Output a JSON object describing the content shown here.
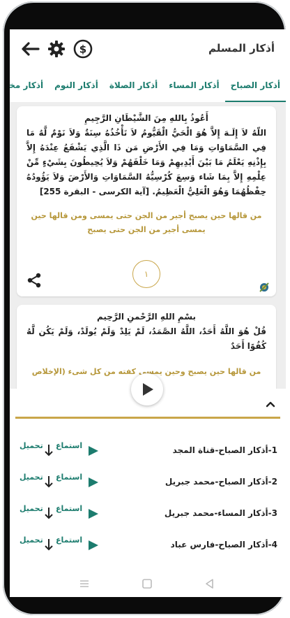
{
  "app": {
    "title": "أذكار المسلم"
  },
  "toolbar": {
    "donate_icon": "dollar-circle-icon",
    "settings_icon": "gear-icon",
    "back_icon": "arrow-left-icon"
  },
  "tabs": [
    {
      "label": "أذكار الصباح",
      "active": true
    },
    {
      "label": "أذكار المساء",
      "active": false
    },
    {
      "label": "أذكار الصلاة",
      "active": false
    },
    {
      "label": "أذكار النوم",
      "active": false
    },
    {
      "label": "أذكار مختارة",
      "active": false
    }
  ],
  "cards": [
    {
      "basmala": "أَعُوذُ بِاللهِ مِنَ الشَّيْطَانِ الرَّجِيمِ",
      "text": "اللّهُ لاَ إِلَـهَ إِلاَّ هُوَ الْحَيُّ الْقَيُّومُ لاَ تَأْخُذُهُ سِنَةٌ وَلاَ نَوْمٌ لَّهُ مَا فِي السَّمَاوَاتِ وَمَا فِي الأَرْضِ مَن ذَا الَّذِي يَشْفَعُ عِنْدَهُ إِلاَّ بِإِذْنِهِ يَعْلَمُ مَا بَيْنَ أَيْدِيهِمْ وَمَا خَلْفَهُمْ وَلاَ يُحِيطُونَ بِشَيْءٍ مِّنْ عِلْمِهِ إِلاَّ بِمَا شَاء وَسِعَ كُرْسِيُّهُ السَّمَاوَاتِ وَالأَرْضَ وَلاَ يَؤُودُهُ حِفْظُهُمَا وَهُوَ الْعَلِيُّ الْعَظِيمُ. [آية الكرسى - البقرة 255]",
      "virtue": "من قالها حين يصبح أجير من الجن حتى يمسى ومن قالها حين يمسى أجير من الجن حتى يصبح",
      "count": "١",
      "share_icon": "share-icon"
    },
    {
      "basmala": "بسْمِ اللهِ الرَّحْمنِ الرَّحِيم",
      "text": "قُلْ هُوَ اللَّهُ أَحَدٌ، اللَّهُ الصَّمَدُ، لَمْ يَلِدْ وَلَمْ يُولَدْ، وَلَمْ يَكُن لَّهُ كُفُوًا أَحَدٌ",
      "virtue": "من قالها حين يصبح وحين يمسى كفته من كل شىء (الإخلاص"
    }
  ],
  "player": {
    "play_icon": "play-icon",
    "collapse_icon": "chevron-up-icon",
    "listen_label": "استماع",
    "download_label": "تحميل",
    "tracks": [
      {
        "title": "1-أذكار الصباح-قناة المجد"
      },
      {
        "title": "2-أذكار الصباح-محمد جبريل"
      },
      {
        "title": "3-أذكار المساء-محمد جبريل"
      },
      {
        "title": "4-أذكار الصباح-فارس عباد"
      }
    ]
  },
  "colors": {
    "accent": "#1c7c6e",
    "gold": "#c9a64a",
    "background": "#eeeeee"
  }
}
